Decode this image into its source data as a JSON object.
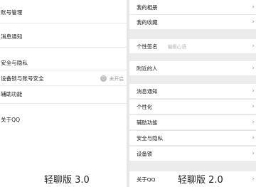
{
  "left": {
    "items": [
      {
        "label": "账号管理"
      },
      {
        "label": "消息通知"
      },
      {
        "label": "安全与隐私"
      },
      {
        "label": "设备锁与账号安全",
        "status": "未开启",
        "status_icon": "lock-icon"
      },
      {
        "label": "辅助功能"
      },
      {
        "label": "关于QQ"
      }
    ],
    "caption": "轻聊版 3.0"
  },
  "right": {
    "items": [
      {
        "label": "我的相册"
      },
      {
        "label": "我的收藏"
      },
      {
        "label": "个性签名",
        "hint": "编辑心语"
      },
      {
        "label": "附近的人"
      },
      {
        "label": "消息通知"
      },
      {
        "label": "个性化"
      },
      {
        "label": "辅助功能"
      },
      {
        "label": "安全与隐私"
      },
      {
        "label": "设备锁"
      },
      {
        "label": "关于QQ"
      }
    ],
    "caption": "轻聊版 2.0"
  }
}
